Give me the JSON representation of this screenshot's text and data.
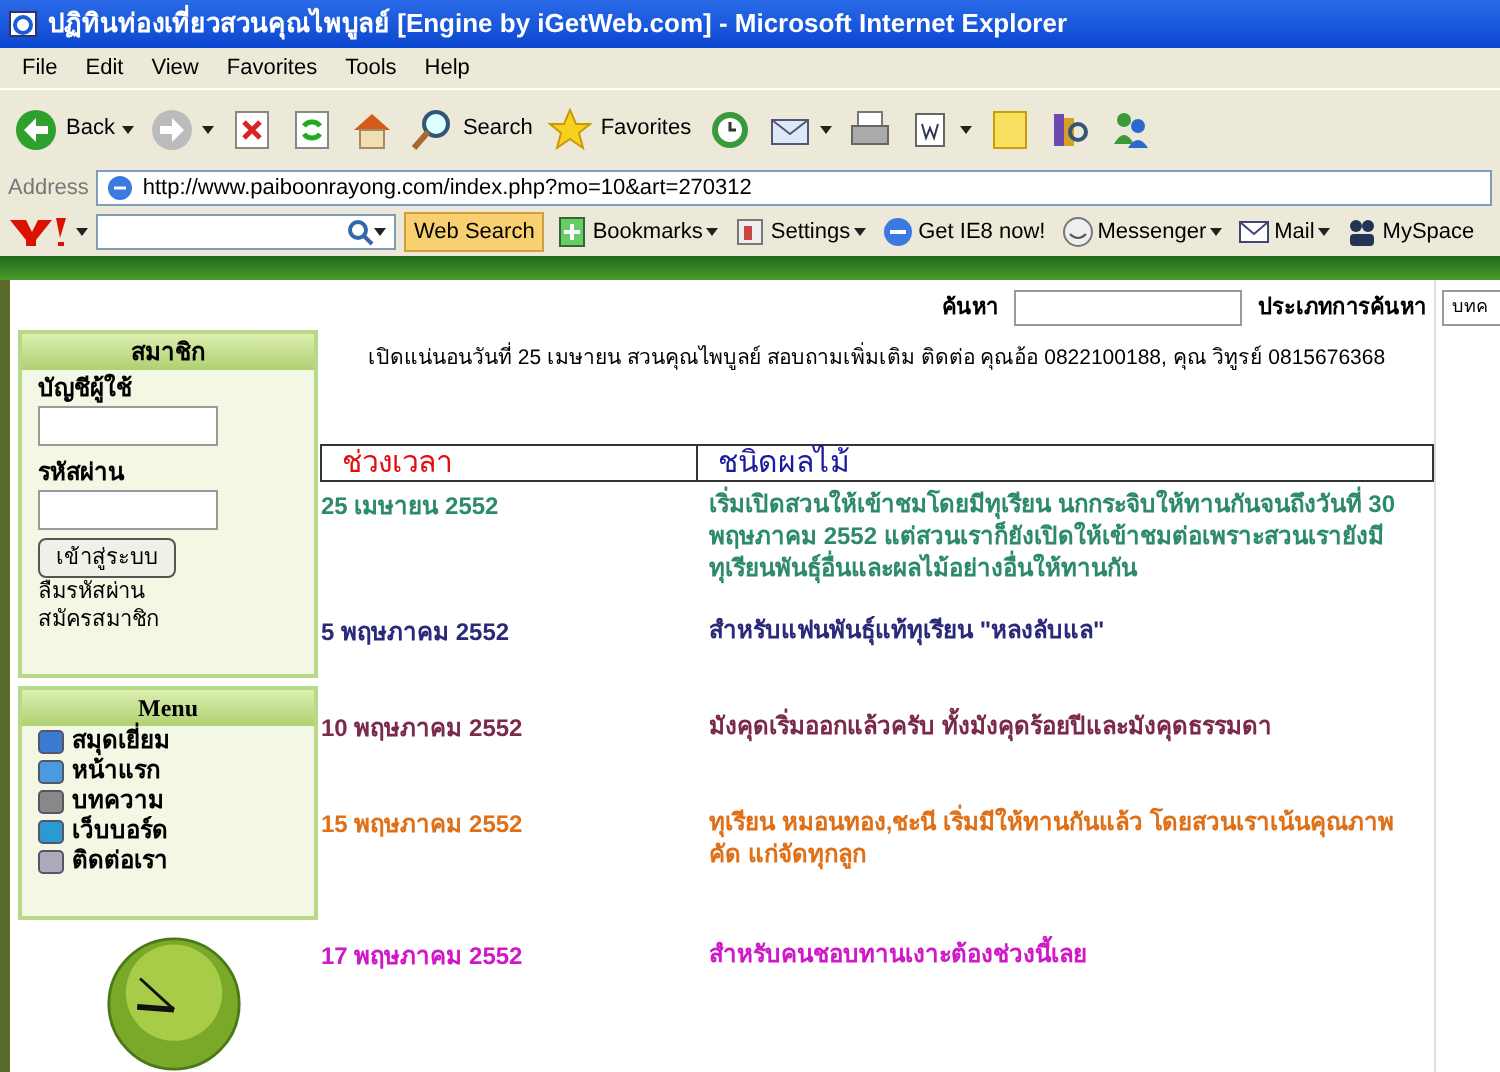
{
  "window": {
    "title": "ปฏิทินท่องเที่ยวสวนคุณไพบูลย์ [Engine by iGetWeb.com] - Microsoft Internet Explorer"
  },
  "menu_bar": [
    "File",
    "Edit",
    "View",
    "Favorites",
    "Tools",
    "Help"
  ],
  "toolbar": [
    {
      "kind": "back",
      "label": "Back",
      "dropdown": true
    },
    {
      "kind": "forward",
      "dropdown": true
    },
    {
      "kind": "stop"
    },
    {
      "kind": "refresh"
    },
    {
      "kind": "home"
    },
    {
      "kind": "search",
      "label": "Search"
    },
    {
      "kind": "favorites",
      "label": "Favorites"
    },
    {
      "kind": "history"
    },
    {
      "kind": "mail",
      "dropdown": true
    },
    {
      "kind": "print"
    },
    {
      "kind": "word",
      "dropdown": true
    },
    {
      "kind": "note"
    },
    {
      "kind": "research"
    },
    {
      "kind": "messenger"
    }
  ],
  "address_bar": {
    "label": "Address",
    "url": "http://www.paiboonrayong.com/index.php?mo=10&art=270312"
  },
  "yahoo_bar": {
    "search_button": "Web Search",
    "items": [
      {
        "kind": "bookmarks",
        "label": "Bookmarks",
        "dropdown": true
      },
      {
        "kind": "settings",
        "label": "Settings",
        "dropdown": true
      },
      {
        "kind": "ie",
        "label": "Get IE8 now!",
        "dropdown": false
      },
      {
        "kind": "messenger",
        "label": "Messenger",
        "dropdown": true
      },
      {
        "kind": "mail",
        "label": "Mail",
        "dropdown": true
      },
      {
        "kind": "myspace",
        "label": "MySpace",
        "dropdown": false
      }
    ]
  },
  "search": {
    "label": "ค้นหา",
    "type_label": "ประเภทการค้นหา",
    "type_value": "บทค"
  },
  "member_box": {
    "title": "สมาชิก",
    "username_label": "บัญชีผู้ใช้",
    "password_label": "รหัสผ่าน",
    "login_button": "เข้าสู่ระบบ",
    "links": [
      "ลืมรหัสผ่าน",
      "สมัครสมาชิก"
    ]
  },
  "menu_box": {
    "title": "Menu",
    "items": [
      {
        "kind": "guestbook",
        "label": "สมุดเยี่ยม"
      },
      {
        "kind": "home",
        "label": "หน้าแรก"
      },
      {
        "kind": "article",
        "label": "บทความ"
      },
      {
        "kind": "webboard",
        "label": "เว็บบอร์ด"
      },
      {
        "kind": "contact",
        "label": "ติดต่อเรา"
      }
    ]
  },
  "announcement": "เปิดแน่นอนวันที่ 25 เมษายน สวนคุณไพบูลย์ สอบถามเพิ่มเติม ติดต่อ คุณอ้อ 0822100188, คุณ วิทูรย์ 0815676368",
  "table": {
    "columns": [
      "ช่วงเวลา",
      "ชนิดผลไม้"
    ],
    "rows": [
      {
        "date": "25 เมษายน 2552",
        "text": "เริ่มเปิดสวนให้เข้าชมโดยมีทุเรียน นกกระจิบให้ทานกันจนถึงวันที่ 30   พฤษภาคม 2552 แต่สวนเราก็ยังเปิดให้เข้าชมต่อเพราะสวนเรายังมีทุเรียนพันธุ์อื่นและผลไม้อย่างอื่นให้ทานกัน",
        "color": "#2e8b6a"
      },
      {
        "date": "5 พฤษภาคม 2552",
        "text": "สำหรับแฟนพันธุ์แท้ทุเรียน \"หลงลับแล\"",
        "color": "#2a2a7a"
      },
      {
        "date": "10 พฤษภาคม 2552",
        "text": "มังคุดเริ่มออกแล้วครับ ทั้งมังคุดร้อยปีและมังคุดธรรมดา",
        "color": "#7a2a4a"
      },
      {
        "date": "15 พฤษภาคม 2552",
        "text": "ทุเรียน หมอนทอง,ชะนี เริ่มมีให้ทานกันแล้ว โดยสวนเราเน้นคุณภาพ คัด แก่จัดทุกลูก",
        "color": "#e07018"
      },
      {
        "date": "17 พฤษภาคม 2552",
        "text": "สำหรับคนชอบทานเงาะต้องช่วงนี้เลย",
        "color": "#d018c8"
      }
    ]
  }
}
